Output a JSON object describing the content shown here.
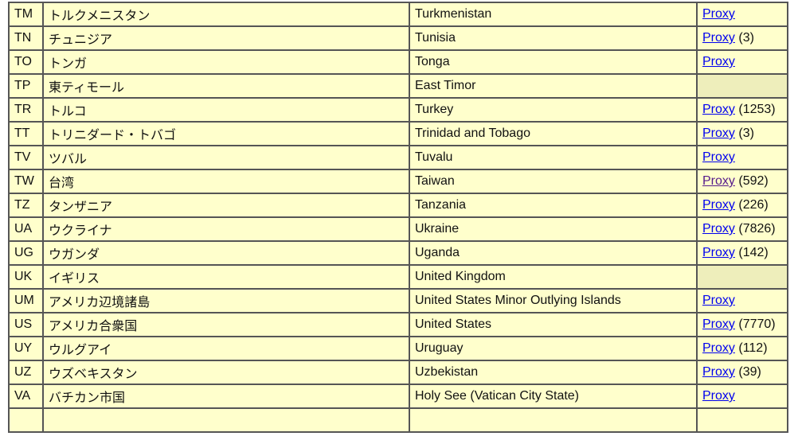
{
  "link_label": "Proxy",
  "colors": {
    "cell_bg": "#ffffcc",
    "empty_cell_bg": "#eeeebb",
    "link": "#0000ee",
    "visited_link": "#551a8b",
    "border": "#555555"
  },
  "rows": [
    {
      "code": "TM",
      "ja": "トルクメニスタン",
      "en": "Turkmenistan",
      "proxy": true,
      "count": ""
    },
    {
      "code": "TN",
      "ja": "チュニジア",
      "en": "Tunisia",
      "proxy": true,
      "count": "(3)"
    },
    {
      "code": "TO",
      "ja": "トンガ",
      "en": "Tonga",
      "proxy": true,
      "count": ""
    },
    {
      "code": "TP",
      "ja": "東ティモール",
      "en": "East Timor",
      "proxy": false,
      "count": ""
    },
    {
      "code": "TR",
      "ja": "トルコ",
      "en": "Turkey",
      "proxy": true,
      "count": "(1253)"
    },
    {
      "code": "TT",
      "ja": "トリニダード・トバゴ",
      "en": "Trinidad and Tobago",
      "proxy": true,
      "count": "(3)"
    },
    {
      "code": "TV",
      "ja": "ツバル",
      "en": "Tuvalu",
      "proxy": true,
      "count": ""
    },
    {
      "code": "TW",
      "ja": "台湾",
      "en": "Taiwan",
      "proxy": true,
      "count": "(592)",
      "visited": true
    },
    {
      "code": "TZ",
      "ja": "タンザニア",
      "en": "Tanzania",
      "proxy": true,
      "count": "(226)"
    },
    {
      "code": "UA",
      "ja": "ウクライナ",
      "en": "Ukraine",
      "proxy": true,
      "count": "(7826)"
    },
    {
      "code": "UG",
      "ja": "ウガンダ",
      "en": "Uganda",
      "proxy": true,
      "count": "(142)"
    },
    {
      "code": "UK",
      "ja": "イギリス",
      "en": "United Kingdom",
      "proxy": false,
      "count": ""
    },
    {
      "code": "UM",
      "ja": "アメリカ辺境諸島",
      "en": "United States Minor Outlying Islands",
      "proxy": true,
      "count": ""
    },
    {
      "code": "US",
      "ja": "アメリカ合衆国",
      "en": "United States",
      "proxy": true,
      "count": "(7770)"
    },
    {
      "code": "UY",
      "ja": "ウルグアイ",
      "en": "Uruguay",
      "proxy": true,
      "count": "(112)"
    },
    {
      "code": "UZ",
      "ja": "ウズベキスタン",
      "en": "Uzbekistan",
      "proxy": true,
      "count": "(39)"
    },
    {
      "code": "VA",
      "ja": "バチカン市国",
      "en": "Holy See (Vatican City State)",
      "proxy": true,
      "count": ""
    }
  ]
}
